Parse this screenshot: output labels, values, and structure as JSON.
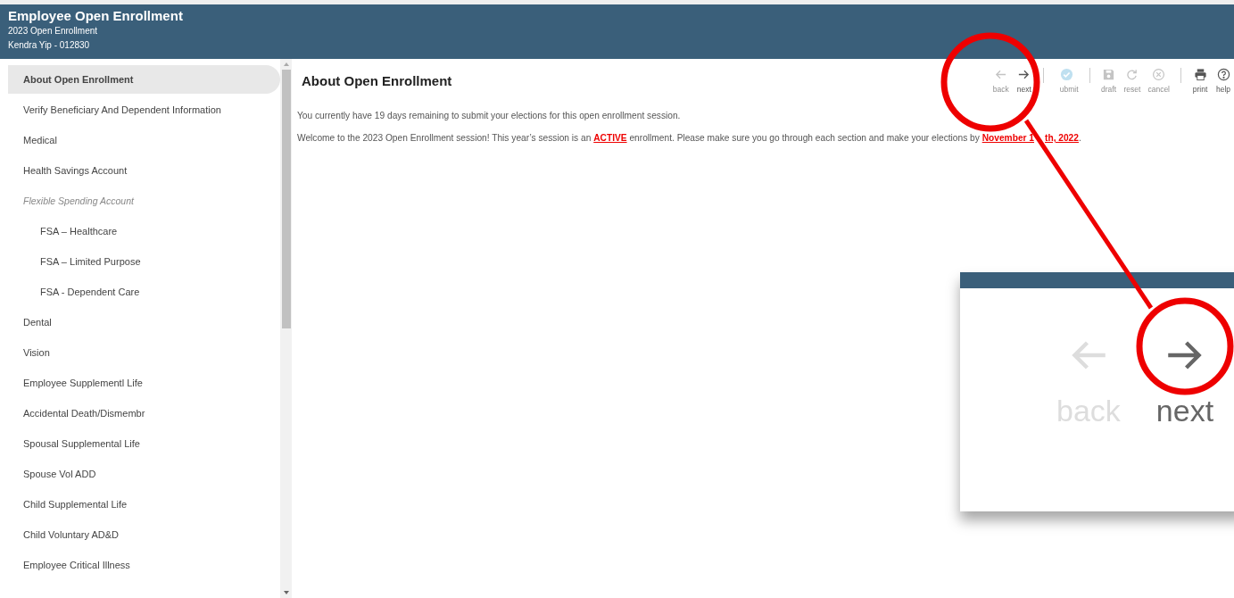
{
  "header": {
    "title": "Employee Open Enrollment",
    "subtitle": "2023 Open Enrollment",
    "user": "Kendra Yip - 012830"
  },
  "sidebar": {
    "items": [
      {
        "label": "About Open Enrollment",
        "selected": true,
        "kind": "link"
      },
      {
        "label": "Verify Beneficiary And Dependent Information",
        "selected": false,
        "kind": "link"
      },
      {
        "label": "Medical",
        "selected": false,
        "kind": "link"
      },
      {
        "label": "Health Savings Account",
        "selected": false,
        "kind": "link"
      },
      {
        "label": "Flexible Spending Account",
        "selected": false,
        "kind": "category",
        "children": [
          {
            "label": "FSA – Healthcare",
            "selected": false,
            "kind": "link"
          },
          {
            "label": "FSA – Limited Purpose",
            "selected": false,
            "kind": "link"
          },
          {
            "label": "FSA - Dependent Care",
            "selected": false,
            "kind": "link"
          }
        ]
      },
      {
        "label": "Dental",
        "selected": false,
        "kind": "link"
      },
      {
        "label": "Vision",
        "selected": false,
        "kind": "link"
      },
      {
        "label": "Employee Supplementl Life",
        "selected": false,
        "kind": "link"
      },
      {
        "label": "Accidental Death/Dismembr",
        "selected": false,
        "kind": "link"
      },
      {
        "label": "Spousal Supplemental Life",
        "selected": false,
        "kind": "link"
      },
      {
        "label": "Spouse Vol ADD",
        "selected": false,
        "kind": "link"
      },
      {
        "label": "Child Supplemental Life",
        "selected": false,
        "kind": "link"
      },
      {
        "label": "Child Voluntary AD&D",
        "selected": false,
        "kind": "link"
      },
      {
        "label": "Employee Critical Illness",
        "selected": false,
        "kind": "link"
      }
    ]
  },
  "page": {
    "title": "About Open Enrollment",
    "toolbar": [
      [
        {
          "kind": "back",
          "label": "back",
          "disabled": true
        },
        {
          "kind": "next",
          "label": "next",
          "disabled": false
        }
      ],
      [
        {
          "kind": "submit",
          "label": "ubmit",
          "disabled": true
        }
      ],
      [
        {
          "kind": "draft",
          "label": "draft",
          "disabled": true
        },
        {
          "kind": "reset",
          "label": "reset",
          "disabled": true
        },
        {
          "kind": "cancel",
          "label": "cancel",
          "disabled": true
        }
      ],
      [
        {
          "kind": "print",
          "label": "print",
          "disabled": false
        },
        {
          "kind": "help",
          "label": "help",
          "disabled": false
        }
      ]
    ],
    "notice": "You currently have 19 days remaining to submit your elections for this open enrollment session.",
    "welcome_before": "Welcome to the 2023 Open Enrollment session! This year’s session is an",
    "welcome_highlight": "ACTIVE",
    "welcome_middle": "enrollment. Please make sure you go through each section and make your elections by",
    "deadline_start": "November 1",
    "deadline_end": "th, 2022",
    "welcome_end": "."
  },
  "callout": {
    "buttons": [
      {
        "kind": "back",
        "label": "back",
        "disabled": true
      },
      {
        "kind": "next",
        "label": "next",
        "disabled": false
      }
    ]
  }
}
